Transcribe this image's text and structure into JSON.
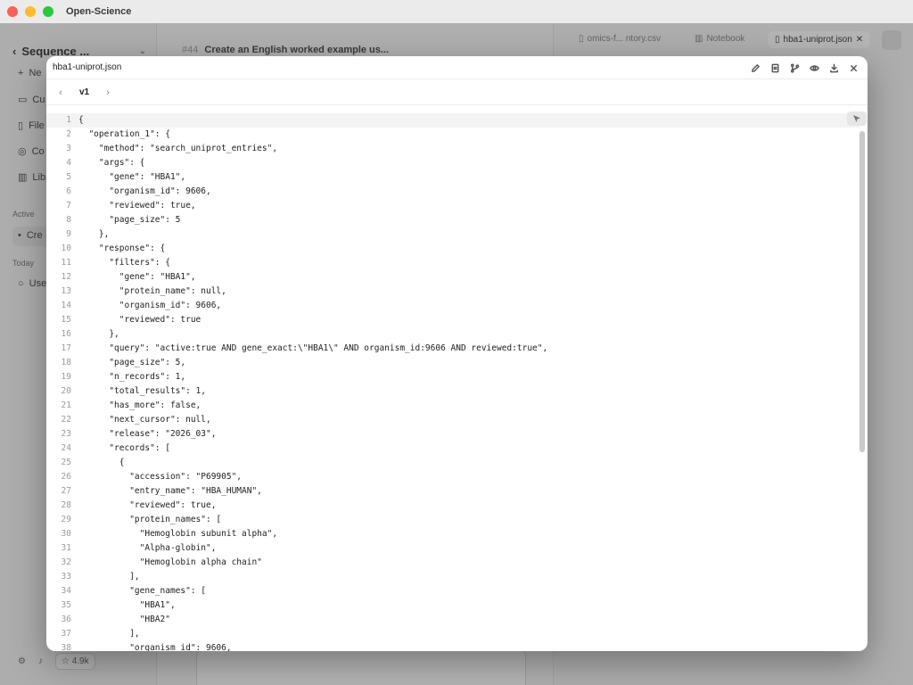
{
  "window": {
    "title": "Open-Science"
  },
  "sidebar": {
    "header": "Sequence ...",
    "items": [
      "Ne",
      "Cu",
      "File",
      "Co",
      "Lib"
    ],
    "sections": {
      "active": "Active",
      "today": "Today"
    },
    "active_item": "Cre",
    "today_item": "Use",
    "github_stars": "4.9k"
  },
  "chat": {
    "number": "#44",
    "title": "Create an English worked example us..."
  },
  "right_tabs": {
    "tab1": "omics-f... ntory.csv",
    "tab2": "Notebook",
    "tab3": "hba1-uniprot.json"
  },
  "modal": {
    "filename": "hba1-uniprot.json",
    "version": "v1",
    "code_lines": [
      "{",
      "  \"operation_1\": {",
      "    \"method\": \"search_uniprot_entries\",",
      "    \"args\": {",
      "      \"gene\": \"HBA1\",",
      "      \"organism_id\": 9606,",
      "      \"reviewed\": true,",
      "      \"page_size\": 5",
      "    },",
      "    \"response\": {",
      "      \"filters\": {",
      "        \"gene\": \"HBA1\",",
      "        \"protein_name\": null,",
      "        \"organism_id\": 9606,",
      "        \"reviewed\": true",
      "      },",
      "      \"query\": \"active:true AND gene_exact:\\\"HBA1\\\" AND organism_id:9606 AND reviewed:true\",",
      "      \"page_size\": 5,",
      "      \"n_records\": 1,",
      "      \"total_results\": 1,",
      "      \"has_more\": false,",
      "      \"next_cursor\": null,",
      "      \"release\": \"2026_03\",",
      "      \"records\": [",
      "        {",
      "          \"accession\": \"P69905\",",
      "          \"entry_name\": \"HBA_HUMAN\",",
      "          \"reviewed\": true,",
      "          \"protein_names\": [",
      "            \"Hemoglobin subunit alpha\",",
      "            \"Alpha-globin\",",
      "            \"Hemoglobin alpha chain\"",
      "          ],",
      "          \"gene_names\": [",
      "            \"HBA1\",",
      "            \"HBA2\"",
      "          ],",
      "          \"organism_id\": 9606,"
    ]
  }
}
